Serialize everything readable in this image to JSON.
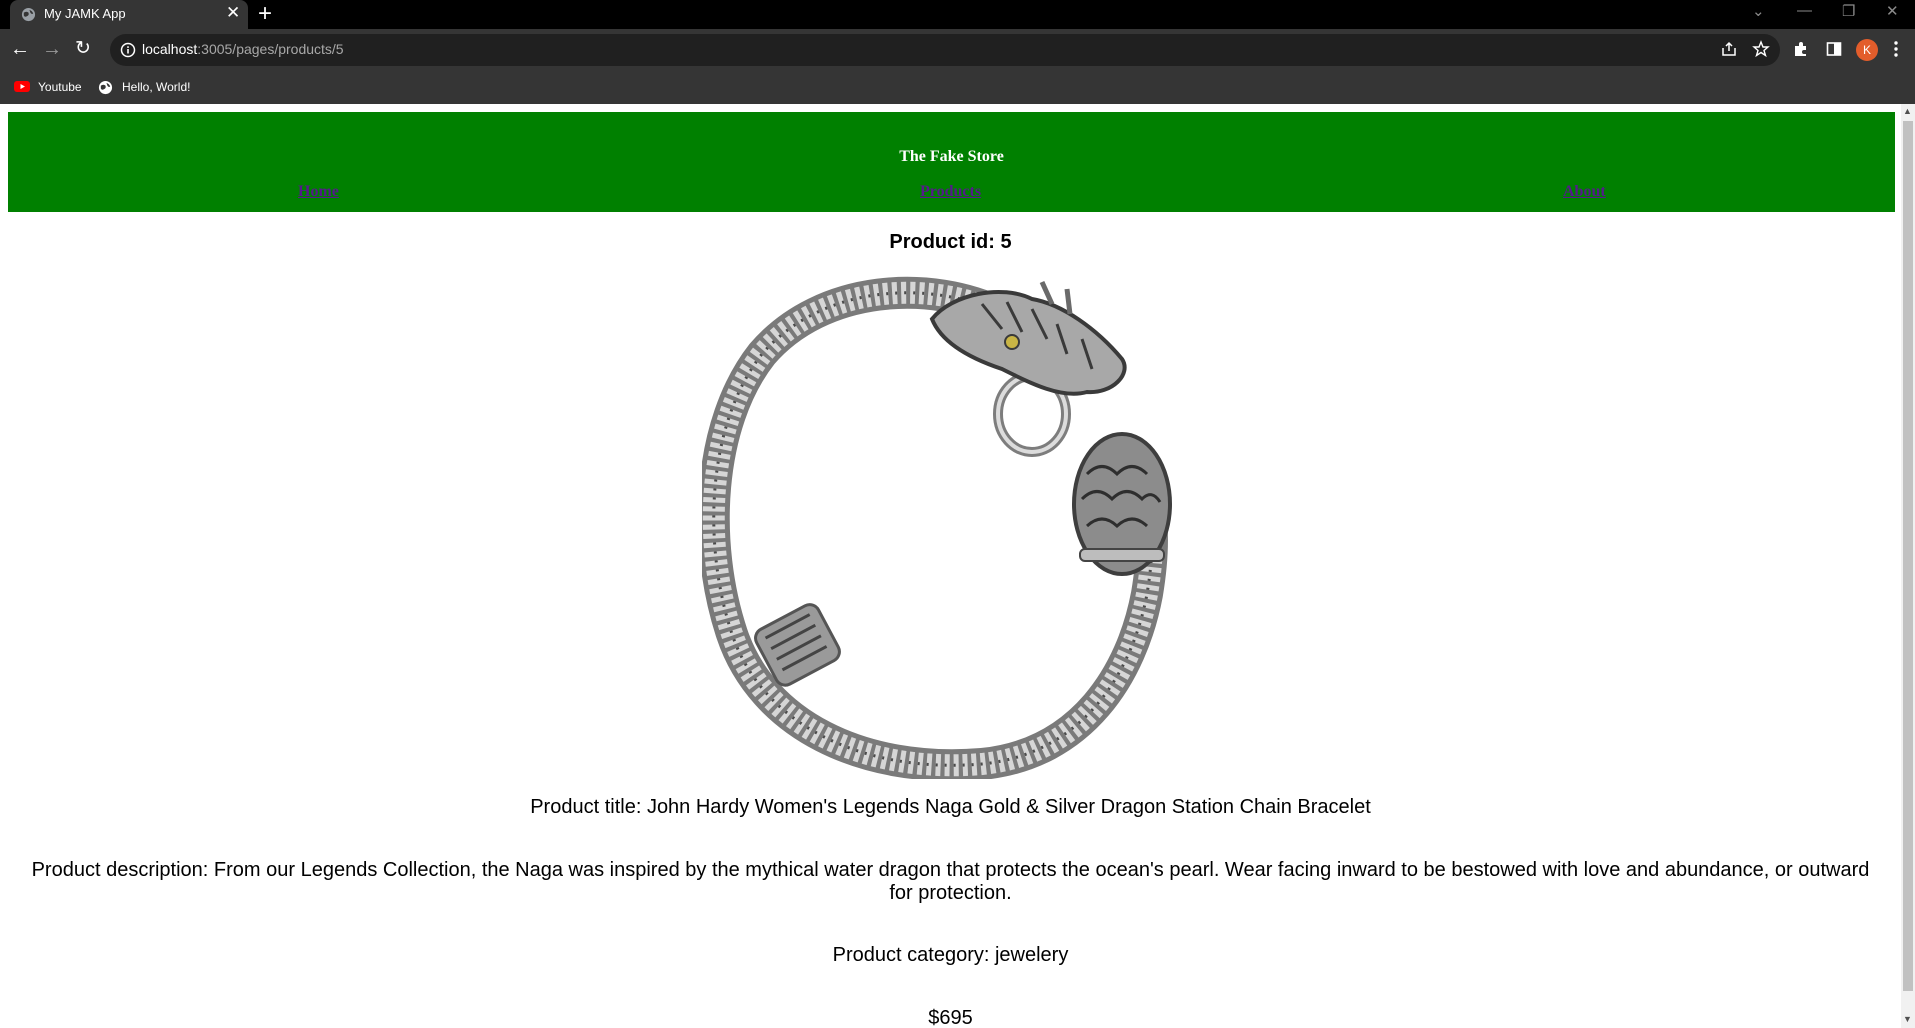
{
  "browser": {
    "tab_title": "My JAMK App",
    "tab_close_glyph": "✕",
    "new_tab_glyph": "+",
    "url_host": "localhost",
    "url_rest": ":3005/pages/products/5",
    "avatar_letter": "K",
    "bookmarks": [
      {
        "label": "Youtube",
        "icon": "youtube-icon"
      },
      {
        "label": "Hello, World!",
        "icon": "globe-icon"
      }
    ]
  },
  "header": {
    "title": "The Fake Store",
    "nav": [
      "Home",
      "Products",
      "About"
    ],
    "background_color": "#008000"
  },
  "product": {
    "id_label": "Product id: 5",
    "title_line": "Product title: John Hardy Women's Legends Naga Gold & Silver Dragon Station Chain Bracelet",
    "description_line": "Product description: From our Legends Collection, the Naga was inspired by the mythical water dragon that protects the ocean's pearl. Wear facing inward to be bestowed with love and abundance, or outward for protection.",
    "category_line": "Product category: jewelery",
    "price_line": "$695",
    "image_subject": "silver dragon-head chain bracelet"
  }
}
